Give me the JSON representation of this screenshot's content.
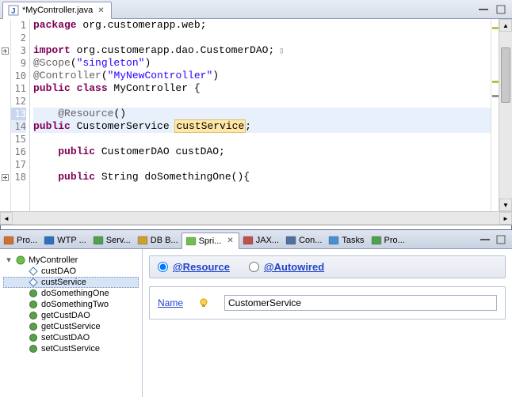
{
  "editor": {
    "tab_title": "*MyController.java",
    "lines": [
      {
        "n": 1,
        "tokens": [
          {
            "t": "package ",
            "c": "kw"
          },
          {
            "t": "org.customerapp.web;",
            "c": ""
          }
        ]
      },
      {
        "n": 2,
        "tokens": []
      },
      {
        "n": 3,
        "fold": true,
        "tokens": [
          {
            "t": "import ",
            "c": "kw"
          },
          {
            "t": "org.customerapp.dao.CustomerDAO;",
            "c": ""
          }
        ],
        "fold_end": true
      },
      {
        "n": 9,
        "tokens": [
          {
            "t": "@Scope",
            "c": "ann"
          },
          {
            "t": "(",
            "c": ""
          },
          {
            "t": "\"singleton\"",
            "c": "str"
          },
          {
            "t": ")",
            "c": ""
          }
        ]
      },
      {
        "n": 10,
        "tokens": [
          {
            "t": "@Controller",
            "c": "ann"
          },
          {
            "t": "(",
            "c": ""
          },
          {
            "t": "\"MyNewController\"",
            "c": "str"
          },
          {
            "t": ")",
            "c": ""
          }
        ]
      },
      {
        "n": 11,
        "tokens": [
          {
            "t": "public class ",
            "c": "kw"
          },
          {
            "t": "MyController {",
            "c": ""
          }
        ]
      },
      {
        "n": 12,
        "tokens": []
      },
      {
        "n": 13,
        "hl": "ln-hl-dark",
        "bg": "hl",
        "indent": 1,
        "tokens": [
          {
            "t": "@Resource",
            "c": "ann"
          },
          {
            "t": "()",
            "c": ""
          }
        ]
      },
      {
        "n": 14,
        "hl": "ln-hl",
        "bg": "hl",
        "tokens": [
          {
            "t": "public ",
            "c": "kw"
          },
          {
            "t": "CustomerService ",
            "c": ""
          },
          {
            "t": "custService",
            "c": "occ"
          },
          {
            "t": ";",
            "c": ""
          }
        ]
      },
      {
        "n": 15,
        "tokens": []
      },
      {
        "n": 16,
        "indent": 1,
        "tokens": [
          {
            "t": "public ",
            "c": "kw"
          },
          {
            "t": "CustomerDAO custDAO;",
            "c": ""
          }
        ]
      },
      {
        "n": 17,
        "tokens": []
      },
      {
        "n": 18,
        "fold": true,
        "indent": 1,
        "tokens": [
          {
            "t": "public ",
            "c": "kw"
          },
          {
            "t": "String doSomethingOne(){",
            "c": ""
          }
        ]
      }
    ]
  },
  "views": {
    "tabs": [
      {
        "label": "Pro...",
        "icon": "project"
      },
      {
        "label": "WTP ...",
        "icon": "wtp"
      },
      {
        "label": "Serv...",
        "icon": "servers"
      },
      {
        "label": "DB B...",
        "icon": "db"
      },
      {
        "label": "Spri...",
        "icon": "spring",
        "active": true
      },
      {
        "label": "JAX...",
        "icon": "jax"
      },
      {
        "label": "Con...",
        "icon": "console"
      },
      {
        "label": "Tasks",
        "icon": "tasks"
      },
      {
        "label": "Pro...",
        "icon": "progress"
      }
    ]
  },
  "outline": {
    "root": "MyController",
    "children": [
      {
        "label": "custDAO",
        "kind": "field"
      },
      {
        "label": "custService",
        "kind": "field",
        "selected": true
      },
      {
        "label": "doSomethingOne",
        "kind": "method"
      },
      {
        "label": "doSomethingTwo",
        "kind": "method"
      },
      {
        "label": "getCustDAO",
        "kind": "method"
      },
      {
        "label": "getCustService",
        "kind": "method"
      },
      {
        "label": "setCustDAO",
        "kind": "method"
      },
      {
        "label": "setCustService",
        "kind": "method"
      }
    ]
  },
  "form": {
    "option_resource": "@Resource",
    "option_autowired": "@Autowired",
    "name_label": "Name",
    "name_value": "CustomerService"
  }
}
